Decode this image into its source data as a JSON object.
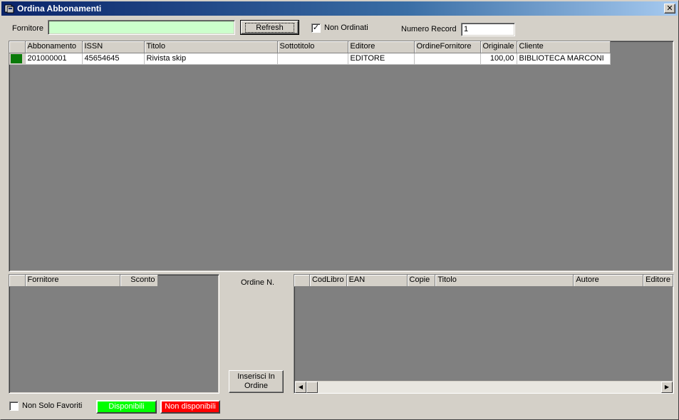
{
  "window": {
    "title": "Ordina Abbonamenti",
    "close_glyph": "✕"
  },
  "toolbar": {
    "fornitore_label": "Fornitore",
    "fornitore_value": "",
    "refresh_label": "Refresh",
    "non_ordinati_label": "Non Ordinati",
    "non_ordinati_checked": true,
    "numero_record_label": "Numero Record",
    "numero_record_value": "1"
  },
  "main_grid": {
    "columns": [
      "Abbonamento",
      "ISSN",
      "Titolo",
      "Sottotitolo",
      "Editore",
      "OrdineFornitore",
      "Originale",
      "Cliente"
    ],
    "rows": [
      [
        "201000001",
        "45654645",
        "Rivista skip",
        "",
        "EDITORE",
        "",
        "100,00",
        "BIBLIOTECA MARCONI"
      ]
    ]
  },
  "supplier_grid": {
    "columns": [
      "Fornitore",
      "Sconto"
    ]
  },
  "order": {
    "ordine_label": "Ordine N.",
    "insert_button_label": "Inserisci In Ordine"
  },
  "order_grid": {
    "columns": [
      "CodLibro",
      "EAN",
      "Copie",
      "Titolo",
      "Autore",
      "Editore"
    ]
  },
  "footer": {
    "non_solo_favoriti_label": "Non Solo Favoriti",
    "non_solo_favoriti_checked": false,
    "disponibili_label": "Disponibili",
    "non_disponibili_label": "Non disponibili"
  },
  "colors": {
    "fornitore_input_bg": "#ccffcc",
    "disponibili_bg": "#00ff00",
    "non_disponibili_bg": "#ff0000",
    "title_gradient_start": "#0a246a"
  }
}
